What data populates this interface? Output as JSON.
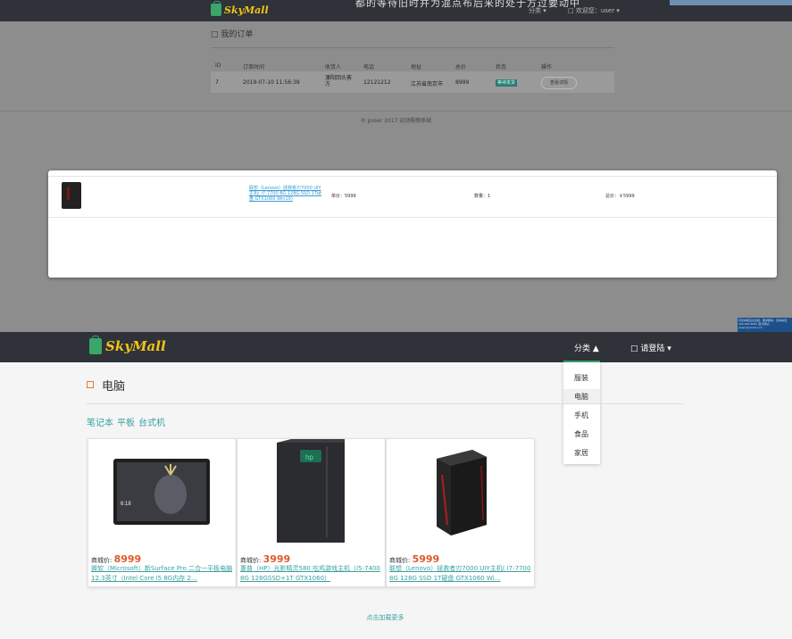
{
  "top": {
    "brand": "SkyMall",
    "cut_text": "都的等待旧时并为混点布后来的处于方过要动中",
    "nav_category": "分类 ▾",
    "nav_user": "□ 欢迎您：user ▾",
    "page_title": "□ 我的订单",
    "table_headers": [
      "ID",
      "订单时间",
      "收货人",
      "电话",
      "地址",
      "总价",
      "状态",
      "操作"
    ],
    "row": {
      "id": "7",
      "time": "2019-07-10 11:56:39",
      "receiver": "溧阳回头客方",
      "phone": "12121212",
      "address": "江苏省南京市",
      "total": "8999",
      "status": "等待发货",
      "action": "查看详情"
    },
    "footer": "® poser 2017 运动购物系统",
    "modal": {
      "product_link": "联想（Lenovo）拯救者刃7000 UIY主机( i7-7700 8G 128G SSD 1T硬盘 GTX1060 Win10)",
      "price": "单价：5999",
      "qty": "数量：1",
      "total": "总价：￥5999"
    },
    "watermark": "有奖举报违法违规，要求删除，咨询电话：400-800-8000 官方网址：www.skymall.com"
  },
  "nav": {
    "brand": "SkyMall",
    "category": "分类 ▲",
    "login": "□ 请登陆 ▾",
    "dropdown": [
      "服装",
      "电脑",
      "手机",
      "食品",
      "家居"
    ]
  },
  "main": {
    "title": "电脑",
    "subcategories": [
      "笔记本",
      "平板",
      "台式机"
    ],
    "products": [
      {
        "price_label": "商城价:",
        "price": "8999",
        "name": "微软（Microsoft）新Surface Pro 二合一平板电脑 12.3英寸（Intel Core i5 8G内存 2…",
        "image": "tablet-image"
      },
      {
        "price_label": "商城价:",
        "price": "3999",
        "name": "惠普（HP）光影精灵580 吃鸡游戏主机（i5-7400 8G 128GSSD+1T GTX1060）",
        "image": "desktop-hp-image"
      },
      {
        "price_label": "商城价:",
        "price": "5999",
        "name": "联想（Lenovo）拯救者刃7000 UIY主机( i7-7700 8G 128G SSD 1T硬盘 GTX1060 Wi…",
        "image": "desktop-lenovo-image"
      }
    ],
    "load_more": "点击加载更多"
  },
  "colors": {
    "nav": "#2f3238",
    "accent": "#3aa0a0",
    "price": "#e05a2a",
    "brand_yellow": "#f0c419",
    "brand_green": "#3aa66a"
  }
}
